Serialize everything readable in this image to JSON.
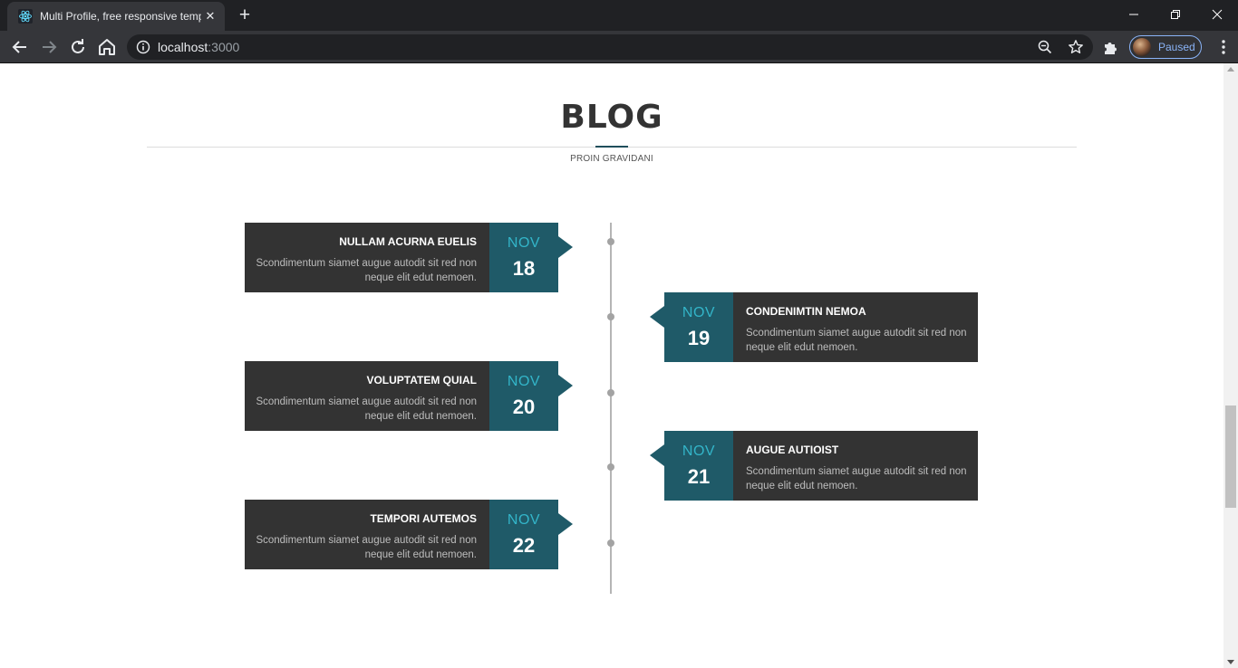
{
  "browser": {
    "tab_title": "Multi Profile, free responsive template",
    "url_host": "localhost",
    "url_port": ":3000",
    "profile_label": "Paused"
  },
  "section": {
    "title": "BLOG",
    "subtitle": "PROIN GRAVIDANI"
  },
  "posts": [
    {
      "month": "NOV",
      "day": "18",
      "title": "NULLAM ACURNA EUELIS",
      "text": "Scondimentum siamet augue autodit sit red non neque elit edut nemoen."
    },
    {
      "month": "NOV",
      "day": "19",
      "title": "CONDENIMTIN NEMOA",
      "text": "Scondimentum siamet augue autodit sit red non neque elit edut nemoen."
    },
    {
      "month": "NOV",
      "day": "20",
      "title": "VOLUPTATEM QUIAL",
      "text": "Scondimentum siamet augue autodit sit red non neque elit edut nemoen."
    },
    {
      "month": "NOV",
      "day": "21",
      "title": "AUGUE AUTIOIST",
      "text": "Scondimentum siamet augue autodit sit red non neque elit edut nemoen."
    },
    {
      "month": "NOV",
      "day": "22",
      "title": "TEMPORI AUTEMOS",
      "text": "Scondimentum siamet augue autodit sit red non neque elit edut nemoen."
    }
  ],
  "icons": {
    "tab_favicon": "react-logo-icon",
    "info": "info-icon",
    "zoom": "zoom-out-icon",
    "bookmark": "star-icon",
    "extensions": "puzzle-icon",
    "menu": "kebab-menu-icon"
  },
  "colors": {
    "date_block": "#1f5a68",
    "month_text": "#33b5c9",
    "post_body": "#333333",
    "title_accent": "#1f4e5b"
  }
}
